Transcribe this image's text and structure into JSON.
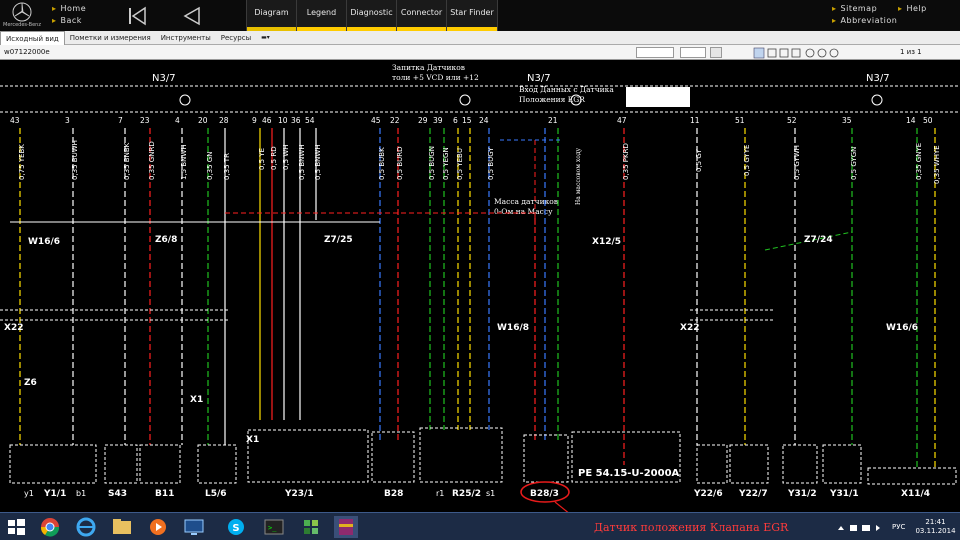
{
  "header": {
    "brand": "Mercedes-Benz",
    "home_label": "Home",
    "back_label": "Back",
    "tabs": [
      "Diagram",
      "Legend",
      "Diagnostic",
      "Connector",
      "Star Finder"
    ],
    "sitemap_label": "Sitemap",
    "help_label": "Help",
    "abbrev_label": "Abbreviation"
  },
  "menu": {
    "items": [
      "Исходный вид",
      "Пометки и измерения",
      "Инструменты",
      "Ресурсы"
    ]
  },
  "toolbar": {
    "doc_id": "w07122000e",
    "page_info": "1 из 1"
  },
  "diagram": {
    "top_labels": [
      "N3/7",
      "N3/7",
      "N3/7"
    ],
    "note_sensor_power": "Запитка Датчиков",
    "note_sensor_power_2": "толи +5 VCD или +12",
    "note_egr_input": "Вход Данных с Датчика",
    "note_egr_input_2": "Положения EGR",
    "note_mass": "Масса датчиков",
    "note_mass_2": "0-Ом на Массу",
    "note_vertical": "На массовом ходу",
    "pins": [
      "43",
      "3",
      "7",
      "23",
      "4",
      "20",
      "28",
      "9",
      "46",
      "10",
      "36",
      "54",
      "45",
      "22",
      "29",
      "39",
      "6",
      "15",
      "24",
      "21",
      "47",
      "11",
      "51",
      "52",
      "35",
      "14",
      "50"
    ],
    "wires": [
      "0,75 YEBK",
      "0,35 BUWH",
      "0,35 BNBK",
      "0,35 GNRD",
      "1,5 BNWH",
      "0,35 GN",
      "0,35 TR",
      "0,5 YE",
      "0,5 RD",
      "0,5 WH",
      "0,5 BNWH",
      "0,5 BNWH",
      "0,5 BUBK",
      "0,5 BURD",
      "0,5 BUGN",
      "0,5 YEGN",
      "0,5 YEBU",
      "0,5 BUGY",
      "0,35 PKRD",
      "0,5 GY",
      "0,5 GYYE",
      "0,5 GYWH",
      "0,5 GYGN",
      "0,35 GNYE",
      "0,35 WHYE"
    ],
    "connectors": [
      "W16/6",
      "Z6/8",
      "Z7/25",
      "X12/5",
      "Z7/24",
      "X22",
      "X22",
      "W16/8",
      "W16/6",
      "Z6",
      "X1",
      "X1"
    ],
    "components": [
      "Y1/1",
      "S43",
      "B11",
      "L5/6",
      "Y23/1",
      "B28",
      "R25/2",
      "B28/3",
      "Y22/6",
      "Y22/7",
      "Y31/2",
      "Y31/1",
      "X11/4"
    ],
    "pe_label": "PE 54.15-U-2000A",
    "sub_labels": [
      "y1",
      "b1",
      "r1",
      "s1"
    ]
  },
  "annotation": "Датчик положения Клапана EGR",
  "taskbar": {
    "lang": "РУС",
    "time": "21:41",
    "date": "03.11.2014"
  },
  "colors": {
    "accent_tab": "#ffcc00",
    "annotation_red": "#e81b1b",
    "wire_yellow": "#ffe000",
    "wire_green": "#20c020",
    "wire_red": "#ff2020",
    "wire_blue": "#3a7aff"
  }
}
